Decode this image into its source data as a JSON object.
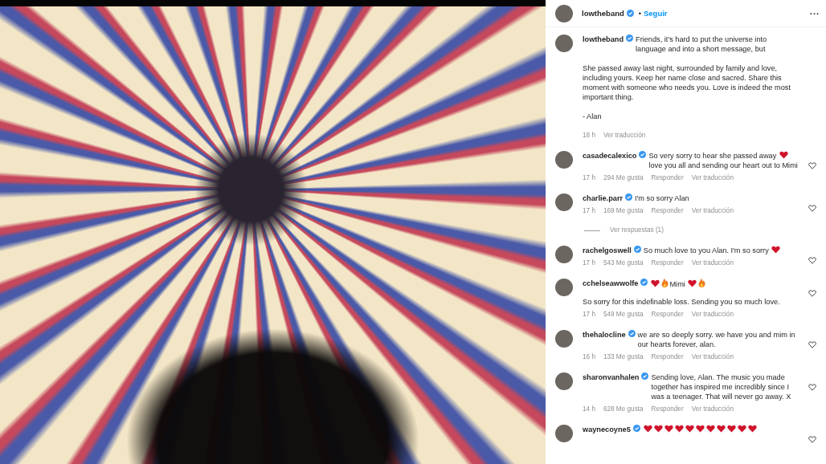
{
  "header": {
    "username": "lowtheband",
    "separator": "•",
    "follow": "Seguir",
    "more": "..."
  },
  "caption": {
    "username": "lowtheband",
    "paragraphs": [
      "Friends, it's hard to put the universe into language and into a short message, but",
      "She passed away last night, surrounded by family and love, including yours. Keep her name close and sacred. Share this moment with someone who needs you. Love is indeed the most important thing.",
      "- Alan"
    ],
    "time": "18 h",
    "translate": "Ver traducción"
  },
  "comments": [
    {
      "username": "casadecalexico",
      "parts": [
        {
          "kind": "text",
          "text": "So very sorry to hear she passed away"
        },
        {
          "kind": "heart"
        },
        {
          "kind": "text",
          "text": "love you all and sending our heart out to Mimi"
        }
      ],
      "time": "17 h",
      "likes": "294 Me gusta",
      "reply": "Responder",
      "translate": "Ver traducción"
    },
    {
      "username": "charlie.parr",
      "parts": [
        {
          "kind": "text",
          "text": "I'm so sorry Alan"
        }
      ],
      "time": "17 h",
      "likes": "169 Me gusta",
      "reply": "Responder",
      "translate": "Ver traducción",
      "replies": "Ver respuestas (1)"
    },
    {
      "username": "rachelgoswell",
      "parts": [
        {
          "kind": "text",
          "text": "So much love to you Alan. I'm so sorry"
        },
        {
          "kind": "heart"
        }
      ],
      "time": "17 h",
      "likes": "543 Me gusta",
      "reply": "Responder",
      "translate": "Ver traducción"
    },
    {
      "username": "cchelseawwolfe",
      "parts": [
        {
          "kind": "heart"
        },
        {
          "kind": "fire"
        },
        {
          "kind": "text",
          "text": "Mimi"
        },
        {
          "kind": "heart"
        },
        {
          "kind": "fire"
        }
      ],
      "more": "So sorry for this indefinable loss. Sending you so much love.",
      "time": "17 h",
      "likes": "549 Me gusta",
      "reply": "Responder",
      "translate": "Ver traducción"
    },
    {
      "username": "thehalocline",
      "parts": [
        {
          "kind": "text",
          "text": "we are so deeply sorry. we have you and mim in our hearts forever, alan."
        }
      ],
      "time": "16 h",
      "likes": "133 Me gusta",
      "reply": "Responder",
      "translate": "Ver traducción"
    },
    {
      "username": "sharonvanhalen",
      "parts": [
        {
          "kind": "text",
          "text": "Sending love, Alan. The music you made together has inspired me incredibly since I was a teenager. That will never go away. X"
        }
      ],
      "time": "14 h",
      "likes": "628 Me gusta",
      "reply": "Responder",
      "translate": "Ver traducción"
    },
    {
      "username": "waynecoyne5",
      "parts": [
        {
          "kind": "heart"
        },
        {
          "kind": "heart"
        },
        {
          "kind": "heart"
        },
        {
          "kind": "heart"
        },
        {
          "kind": "heart"
        },
        {
          "kind": "heart"
        },
        {
          "kind": "heart"
        },
        {
          "kind": "heart"
        },
        {
          "kind": "heart"
        },
        {
          "kind": "heart"
        },
        {
          "kind": "heart"
        }
      ]
    }
  ]
}
